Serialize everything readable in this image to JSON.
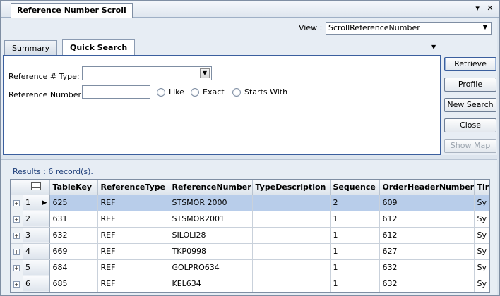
{
  "window": {
    "tab_title": "Reference Number Scroll",
    "menu_glyph": "▾",
    "close_glyph": "✕"
  },
  "view": {
    "label": "View :",
    "selected": "ScrollReferenceNumber"
  },
  "tabs": [
    {
      "label": "Summary"
    },
    {
      "label": "Quick Search"
    }
  ],
  "search": {
    "ref_type_label": "Reference # Type:",
    "ref_type_value": "",
    "ref_number_label": "Reference Number:",
    "ref_number_value": "",
    "options": [
      "Like",
      "Exact",
      "Starts With"
    ]
  },
  "buttons": {
    "retrieve": "Retrieve",
    "profile": "Profile",
    "new_search": "New Search",
    "close": "Close",
    "show_map": "Show Map"
  },
  "results": {
    "label": "Results : 6 record(s).",
    "columns": [
      "TableKey",
      "ReferenceType",
      "ReferenceNumber",
      "TypeDescription",
      "Sequence",
      "OrderHeaderNumber",
      "Tir"
    ],
    "rows": [
      {
        "num": "1",
        "cells": [
          "625",
          "REF",
          "STSMOR 2000",
          "",
          "2",
          "609",
          "Sy"
        ]
      },
      {
        "num": "2",
        "cells": [
          "631",
          "REF",
          "STSMOR2001",
          "",
          "1",
          "612",
          "Sy"
        ]
      },
      {
        "num": "3",
        "cells": [
          "632",
          "REF",
          "SILOLI28",
          "",
          "1",
          "612",
          "Sy"
        ]
      },
      {
        "num": "4",
        "cells": [
          "669",
          "REF",
          "TKP0998",
          "",
          "1",
          "627",
          "Sy"
        ]
      },
      {
        "num": "5",
        "cells": [
          "684",
          "REF",
          "GOLPRO634",
          "",
          "1",
          "632",
          "Sy"
        ]
      },
      {
        "num": "6",
        "cells": [
          "685",
          "REF",
          "KEL634",
          "",
          "1",
          "632",
          "Sy"
        ]
      }
    ]
  }
}
